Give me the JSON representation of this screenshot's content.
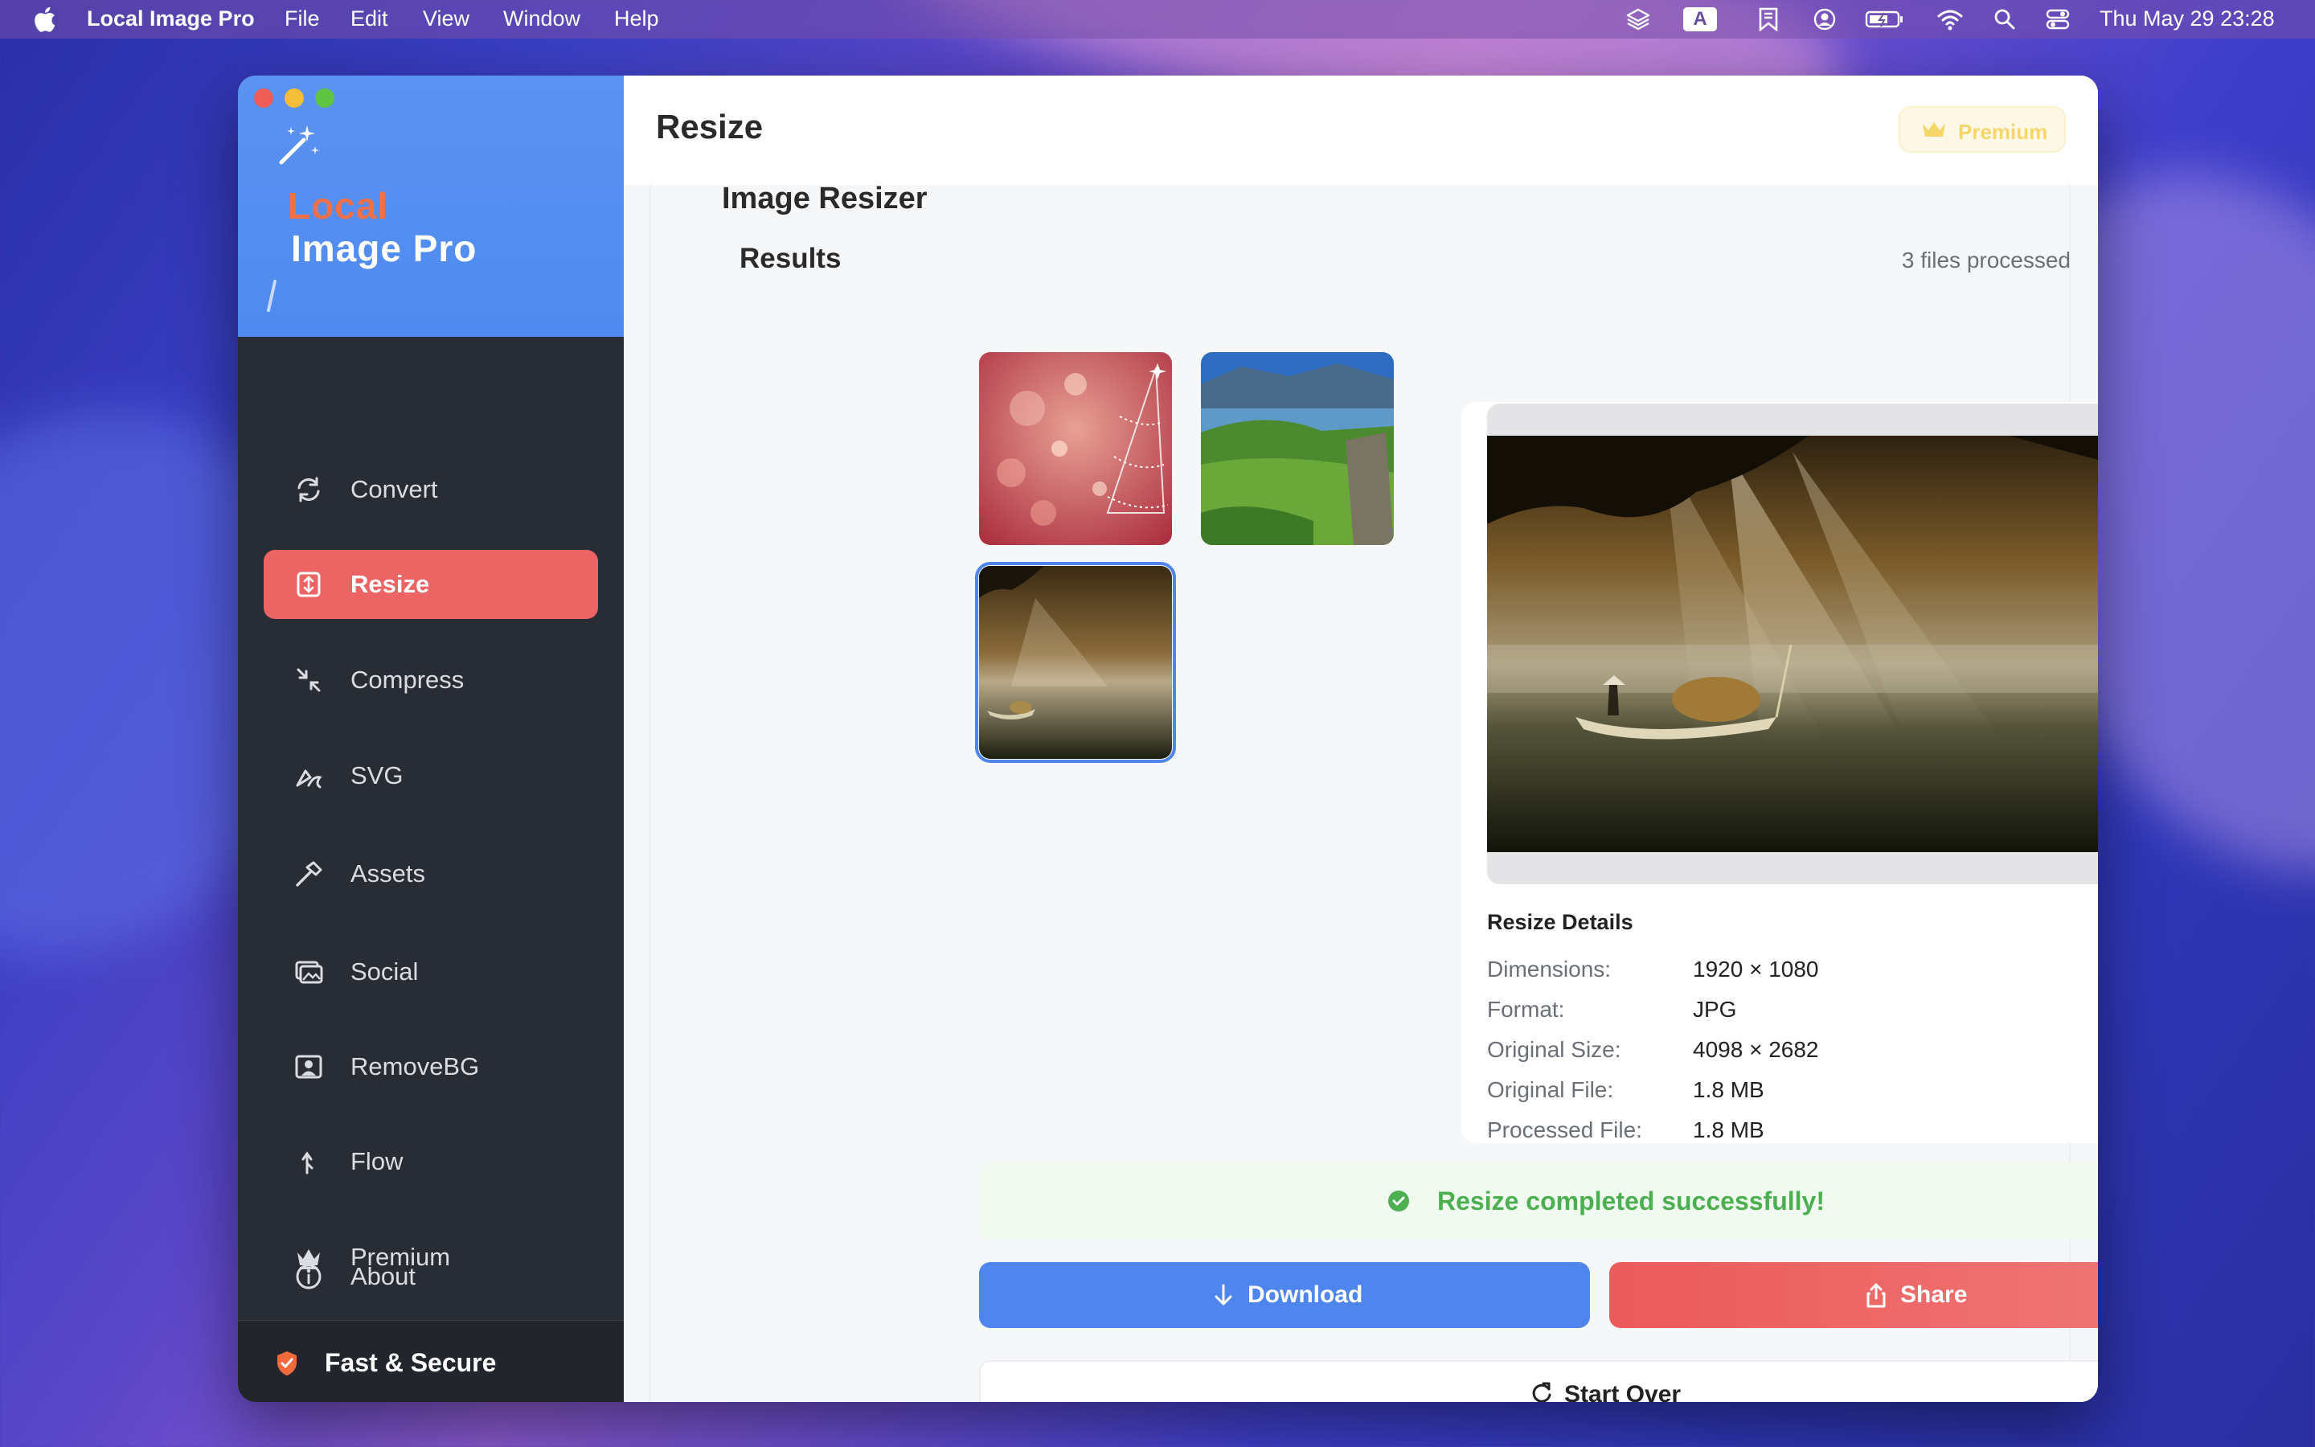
{
  "menubar": {
    "app_name": "Local Image Pro",
    "menus": [
      "File",
      "Edit",
      "View",
      "Window",
      "Help"
    ],
    "clock": "Thu May 29  23:28",
    "input_source": "A"
  },
  "sidebar": {
    "logo_line1": "Local",
    "logo_line2": "Image Pro",
    "items": [
      {
        "label": "Convert",
        "icon": "refresh-icon"
      },
      {
        "label": "Resize",
        "icon": "resize-icon"
      },
      {
        "label": "Compress",
        "icon": "compress-icon"
      },
      {
        "label": "SVG",
        "icon": "pen-icon"
      },
      {
        "label": "Assets",
        "icon": "hammer-icon"
      },
      {
        "label": "Social",
        "icon": "photos-icon"
      },
      {
        "label": "RemoveBG",
        "icon": "person-frame-icon"
      },
      {
        "label": "Flow",
        "icon": "flow-icon"
      },
      {
        "label": "Premium",
        "icon": "crown-icon"
      },
      {
        "label": "About",
        "icon": "info-icon"
      }
    ],
    "active": "Resize",
    "footer": "Fast & Secure"
  },
  "header": {
    "title": "Resize",
    "premium_label": "Premium"
  },
  "main": {
    "section_title": "Image Resizer",
    "results_title": "Results",
    "files_processed": "3 files processed",
    "details": {
      "heading": "Resize Details",
      "rows": [
        {
          "key": "Dimensions:",
          "value": "1920 × 1080"
        },
        {
          "key": "Format:",
          "value": "JPG"
        },
        {
          "key": "Original Size:",
          "value": "4098 × 2682"
        },
        {
          "key": "Original File:",
          "value": "1.8 MB"
        },
        {
          "key": "Processed File:",
          "value": "1.8 MB"
        }
      ]
    },
    "success_message": "Resize completed successfully!",
    "download_label": "Download",
    "share_label": "Share",
    "start_over_label": "Start Over"
  },
  "colors": {
    "accent_blue": "#4f86ee",
    "accent_red": "#ec6464",
    "success_green": "#4caf50",
    "sidebar_bg": "#282c34"
  }
}
